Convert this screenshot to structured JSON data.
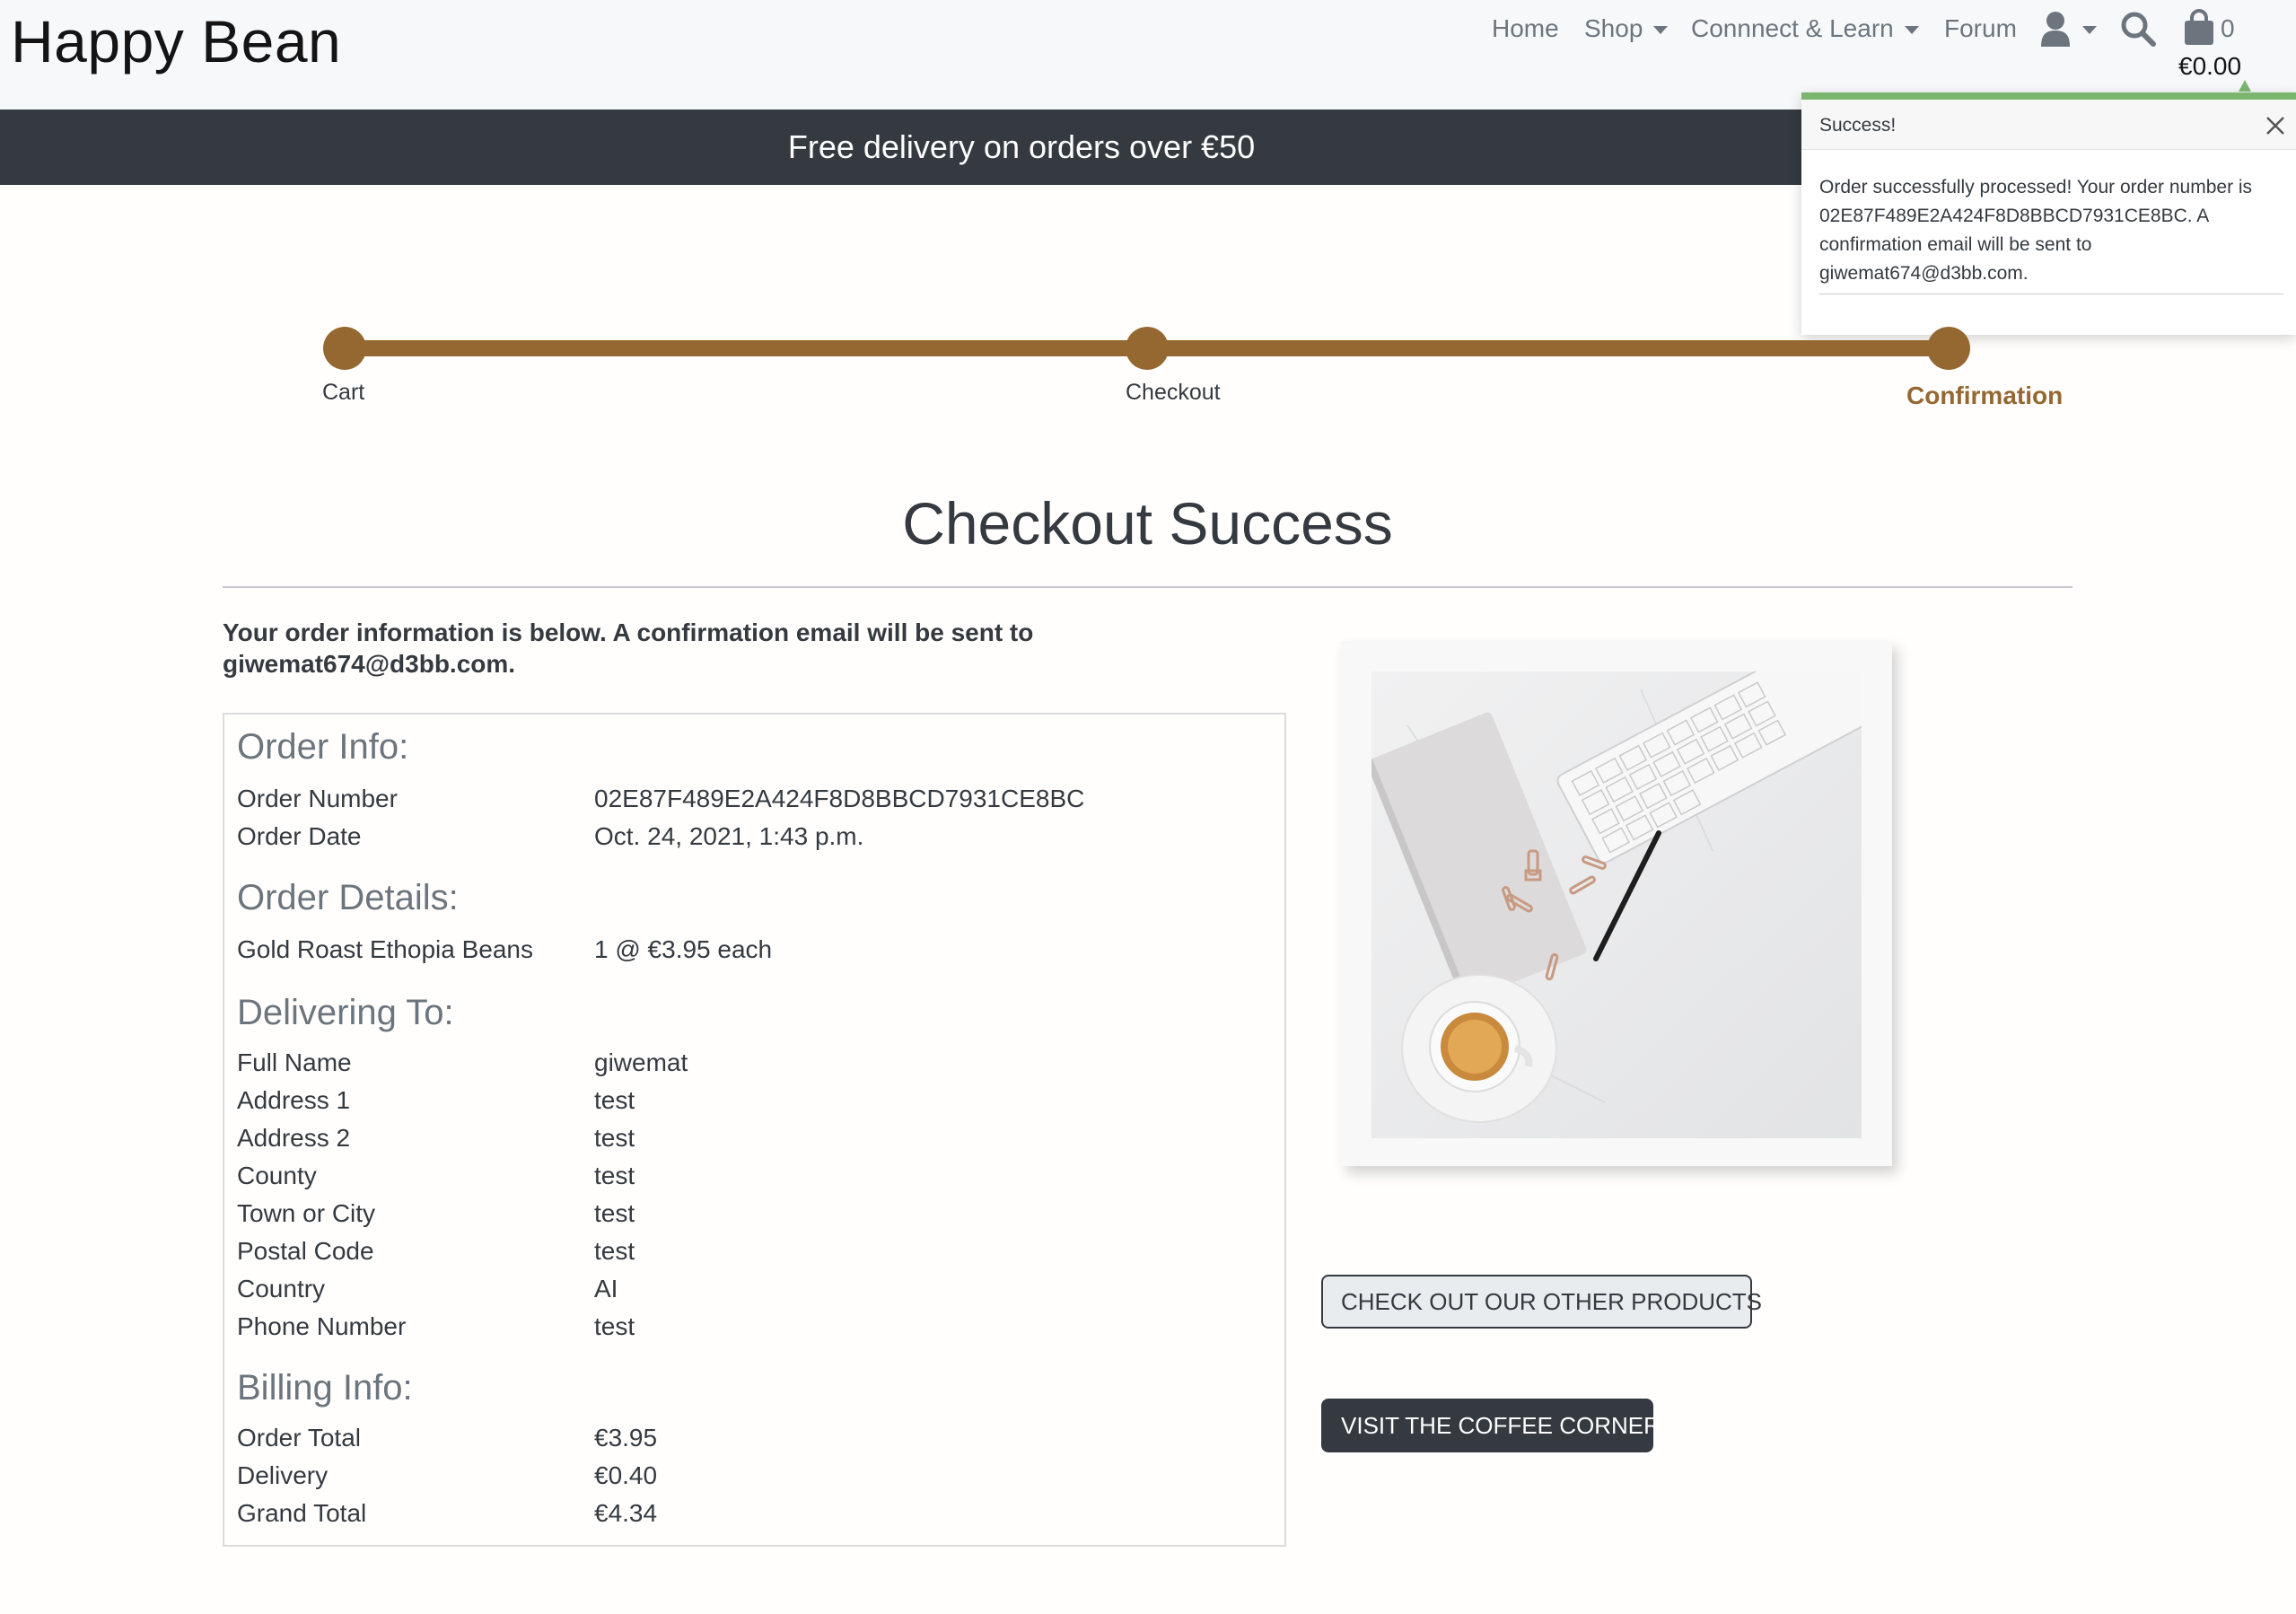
{
  "brand": "Happy Bean",
  "nav": {
    "home": "Home",
    "shop": "Shop",
    "connect": "Connnect & Learn",
    "forum": "Forum",
    "cart_count": "0",
    "cart_total": "€0.00",
    "icons": [
      "user-icon",
      "search-icon",
      "shopping-bag-icon"
    ]
  },
  "banner": "Free delivery on orders over €50",
  "toast": {
    "title": "Success!",
    "message": "Order successfully processed! Your order number is 02E87F489E2A424F8D8BBCD7931CE8BC. A confirmation email will be sent to giwemat674@d3bb.com.",
    "accent_color": "#7bb56e"
  },
  "progress": {
    "steps": [
      "Cart",
      "Checkout",
      "Confirmation"
    ],
    "active": "Confirmation",
    "color": "#956831"
  },
  "page_title": "Checkout Success",
  "intro": "Your order information is below. A confirmation email will be sent to giwemat674@d3bb.com.",
  "order": {
    "info_heading": "Order Info:",
    "order_number_label": "Order Number",
    "order_number": "02E87F489E2A424F8D8BBCD7931CE8BC",
    "order_date_label": "Order Date",
    "order_date": "Oct. 24, 2021, 1:43 p.m.",
    "details_heading": "Order Details:",
    "items": [
      {
        "name": "Gold Roast Ethopia Beans",
        "qty_price": "1 @ €3.95 each"
      }
    ],
    "delivery_heading": "Delivering To:",
    "delivery": [
      {
        "label": "Full Name",
        "value": "giwemat"
      },
      {
        "label": "Address 1",
        "value": "test"
      },
      {
        "label": "Address 2",
        "value": "test"
      },
      {
        "label": "County",
        "value": "test"
      },
      {
        "label": "Town or City",
        "value": "test"
      },
      {
        "label": "Postal Code",
        "value": "test"
      },
      {
        "label": "Country",
        "value": "AI"
      },
      {
        "label": "Phone Number",
        "value": "test"
      }
    ],
    "billing_heading": "Billing Info:",
    "billing": [
      {
        "label": "Order Total",
        "value": "€3.95"
      },
      {
        "label": "Delivery",
        "value": "€0.40"
      },
      {
        "label": "Grand Total",
        "value": "€4.34"
      }
    ]
  },
  "buttons": {
    "products": "CHECK OUT OUR OTHER PRODUCTS",
    "coffee_corner": "VISIT THE COFFEE CORNER"
  }
}
